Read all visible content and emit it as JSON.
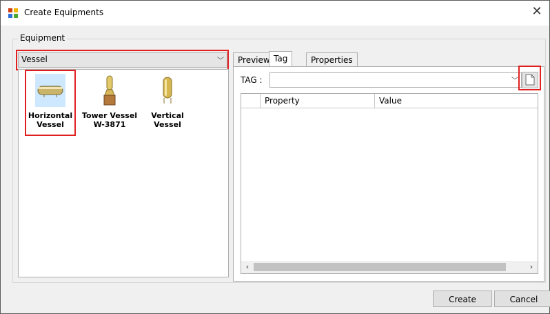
{
  "window": {
    "title": "Create Equipments",
    "close_glyph": "✕"
  },
  "equipment_group": {
    "legend": "Equipment",
    "category_select": {
      "value": "Vessel",
      "arrow": "﹀"
    },
    "items": [
      {
        "label": "Horizontal Vessel",
        "icon": "horizontal-vessel-icon",
        "selected": true
      },
      {
        "label": "Tower Vessel W-3871",
        "icon": "tower-vessel-icon",
        "selected": false
      },
      {
        "label": "Vertical Vessel",
        "icon": "vertical-vessel-icon",
        "selected": false
      }
    ]
  },
  "tabs": [
    {
      "label": "Preview",
      "active": false
    },
    {
      "label": "Tag",
      "active": true
    },
    {
      "label": "Properties",
      "active": false
    }
  ],
  "tag_panel": {
    "tag_label": "TAG :",
    "tag_value": "",
    "arrow": "﹀",
    "grid": {
      "columns": [
        "",
        "Property",
        "Value"
      ],
      "rows": []
    },
    "scroll_left": "‹",
    "scroll_right": "›"
  },
  "buttons": {
    "create": "Create",
    "cancel": "Cancel"
  },
  "colors": {
    "highlight": "#e02020",
    "selection": "#cde8ff"
  }
}
